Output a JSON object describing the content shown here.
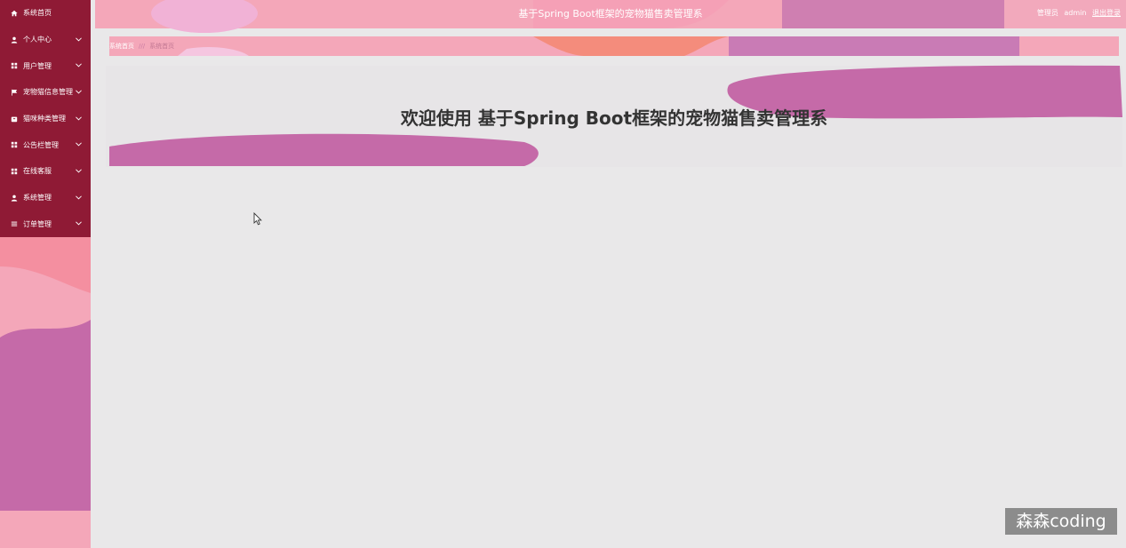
{
  "header": {
    "title": "基于Spring Boot框架的宠物猫售卖管理系",
    "role": "管理员",
    "username": "admin",
    "logout": "退出登录"
  },
  "sidebar": {
    "items": [
      {
        "label": "系统首页",
        "icon": "home-icon",
        "has_children": false
      },
      {
        "label": "个人中心",
        "icon": "user-icon",
        "has_children": true
      },
      {
        "label": "用户管理",
        "icon": "grid-icon",
        "has_children": true
      },
      {
        "label": "宠物猫信息管理",
        "icon": "flag-icon",
        "has_children": true
      },
      {
        "label": "猫咪种类管理",
        "icon": "box-icon",
        "has_children": true
      },
      {
        "label": "公告栏管理",
        "icon": "grid-icon",
        "has_children": true
      },
      {
        "label": "在线客服",
        "icon": "grid-icon",
        "has_children": true
      },
      {
        "label": "系统管理",
        "icon": "user-icon",
        "has_children": true
      },
      {
        "label": "订单管理",
        "icon": "list-icon",
        "has_children": true
      }
    ]
  },
  "breadcrumb": {
    "home": "系统首页",
    "separator": "///",
    "current": "系统首页"
  },
  "main": {
    "welcome": "欢迎使用 基于Spring Boot框架的宠物猫售卖管理系"
  },
  "watermark": "森森coding",
  "colors": {
    "sidebar_bg": "#8f1a35",
    "pink": "#f4a7b9",
    "purple": "#c56aa8",
    "orange": "#f48c7c",
    "content_bg": "#e9e8e9"
  }
}
